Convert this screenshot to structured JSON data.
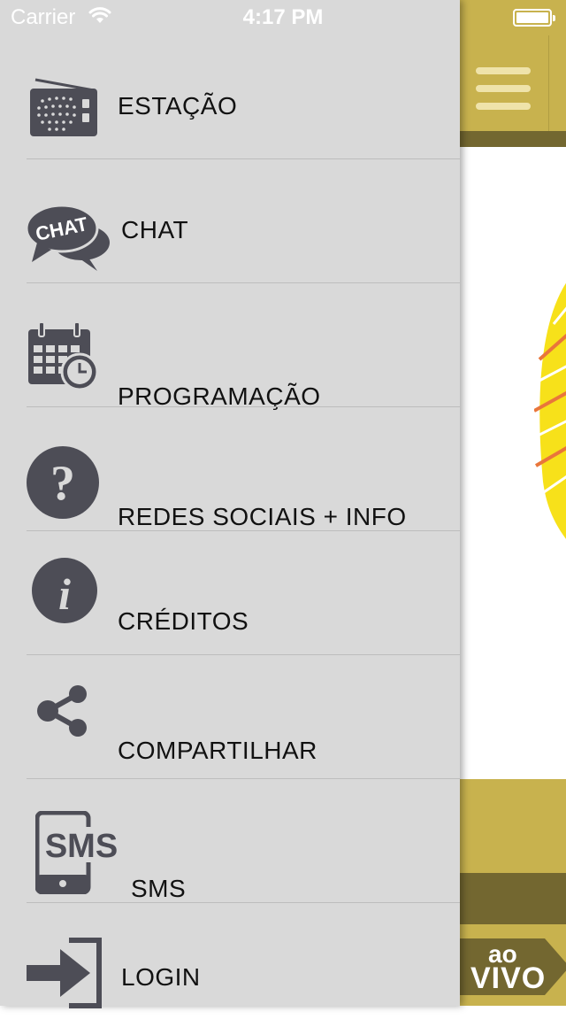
{
  "status_bar": {
    "carrier": "Carrier",
    "time": "4:17 PM"
  },
  "menu": {
    "items": [
      {
        "label": "ESTAÇÃO",
        "icon": "radio-icon"
      },
      {
        "label": "CHAT",
        "icon": "chat-bubble-icon"
      },
      {
        "label": "PROGRAMAÇÃO",
        "icon": "calendar-clock-icon"
      },
      {
        "label": "REDES SOCIAIS + INFO",
        "icon": "question-icon"
      },
      {
        "label": "CRÉDITOS",
        "icon": "info-icon"
      },
      {
        "label": "COMPARTILHAR",
        "icon": "share-icon"
      },
      {
        "label": "SMS",
        "icon": "sms-phone-icon"
      },
      {
        "label": "LOGIN",
        "icon": "login-icon"
      }
    ]
  },
  "icon_texts": {
    "chat": "CHAT",
    "question": "?",
    "info": "i",
    "sms": "SMS"
  },
  "background_app": {
    "live_badge": {
      "line1": "ao",
      "line2": "VIVO"
    }
  },
  "colors": {
    "drawer_bg": "#d9d9d9",
    "header_gold": "#c8b24e",
    "header_dark": "#736730",
    "icon_gray": "#4d4d56",
    "logo_yellow": "#f7e11a"
  }
}
